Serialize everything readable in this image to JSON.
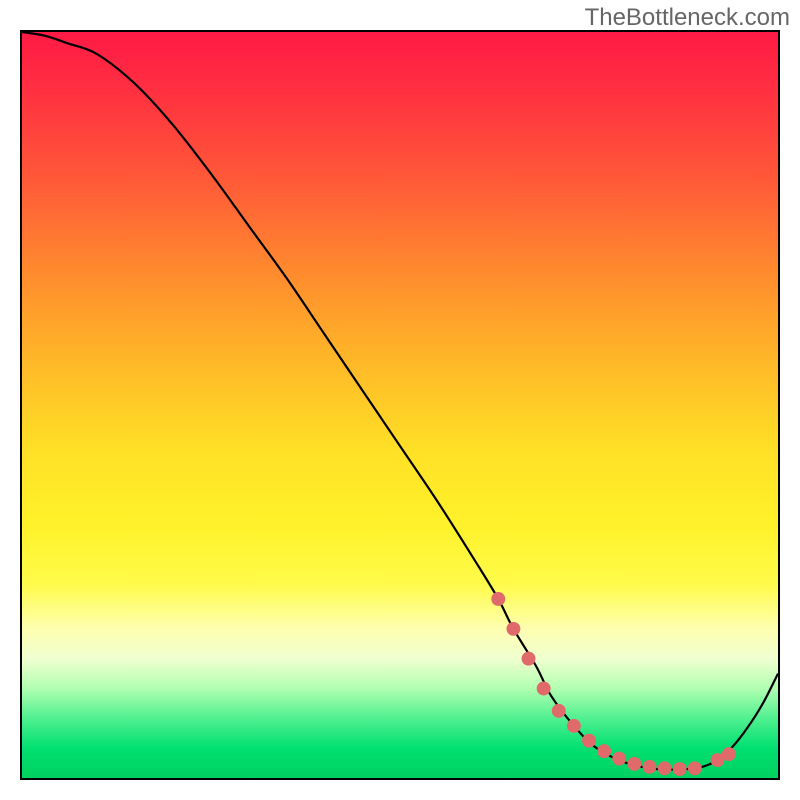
{
  "attribution": "TheBottleneck.com",
  "chart_data": {
    "type": "line",
    "title": "",
    "xlabel": "",
    "ylabel": "",
    "xlim": [
      0,
      100
    ],
    "ylim": [
      0,
      100
    ],
    "series": [
      {
        "name": "bottleneck-curve",
        "x": [
          0,
          3,
          6,
          10,
          15,
          20,
          25,
          30,
          35,
          40,
          45,
          50,
          55,
          60,
          63,
          65,
          68,
          70,
          73,
          76,
          80,
          84,
          88,
          90,
          92,
          94,
          96,
          98,
          100
        ],
        "values": [
          100,
          99.5,
          98.5,
          97,
          93,
          87.5,
          81,
          74,
          67,
          59.5,
          52,
          44.5,
          37,
          29,
          24,
          20,
          15,
          11,
          7,
          4,
          2,
          1.2,
          1.2,
          1.5,
          2.4,
          4.2,
          6.8,
          10,
          14
        ]
      }
    ],
    "markers": {
      "name": "highlight-dots",
      "color": "#e06a6a",
      "x": [
        63,
        65,
        67,
        69,
        71,
        73,
        75,
        77,
        79,
        81,
        83,
        85,
        87,
        89,
        92,
        93.5
      ],
      "values": [
        24,
        20,
        16,
        12,
        9,
        7,
        5,
        3.6,
        2.6,
        1.9,
        1.5,
        1.3,
        1.2,
        1.3,
        2.4,
        3.2
      ]
    }
  }
}
